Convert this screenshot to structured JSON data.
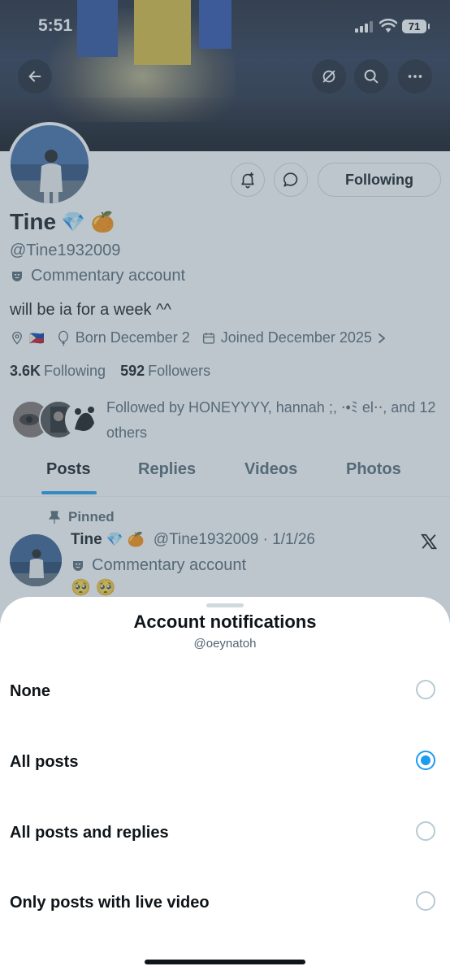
{
  "status_bar": {
    "time": "5:51",
    "battery": "71"
  },
  "profile": {
    "name": "Tine",
    "name_emojis": "💎 🍊",
    "handle": "@Tine1932009",
    "account_label": "Commentary account",
    "bio": "will be ia for a week ^^",
    "location_flag": "🇵🇭",
    "born": "Born December 2",
    "joined": "Joined December 2025",
    "following_count": "3.6K",
    "following_label": "Following",
    "followers_count": "592",
    "followers_label": "Followers",
    "followed_by": "Followed by HONEYYYY, hannah ;, ⋅•ﾐ el⋅⋅, and 12 others",
    "following_button": "Following"
  },
  "tabs": [
    "Posts",
    "Replies",
    "Videos",
    "Photos"
  ],
  "pinned_post": {
    "pinned_label": "Pinned",
    "name": "Tine",
    "name_emojis": "💎 🍊",
    "handle_date": "@Tine1932009 · 1/1/26",
    "account_label": "Commentary account",
    "content": "🥺 🥺"
  },
  "sheet": {
    "title": "Account notifications",
    "subtitle": "@oeynatoh",
    "options": [
      {
        "label": "None",
        "selected": false
      },
      {
        "label": "All posts",
        "selected": true
      },
      {
        "label": "All posts and replies",
        "selected": false
      },
      {
        "label": "Only posts with live video",
        "selected": false
      }
    ]
  },
  "icons": {
    "back": "arrow-left-icon",
    "mute": "notifications-off-icon",
    "search": "search-icon",
    "more": "more-horizontal-icon",
    "notify": "bell-plus-icon",
    "message": "message-bubble-icon",
    "location": "location-pin-icon",
    "balloon": "balloon-icon",
    "calendar": "calendar-icon",
    "pin": "pin-icon",
    "x_logo": "x-logo-icon"
  },
  "colors": {
    "accent": "#1d9bf0",
    "text": "#0f1419",
    "secondary": "#536471"
  }
}
